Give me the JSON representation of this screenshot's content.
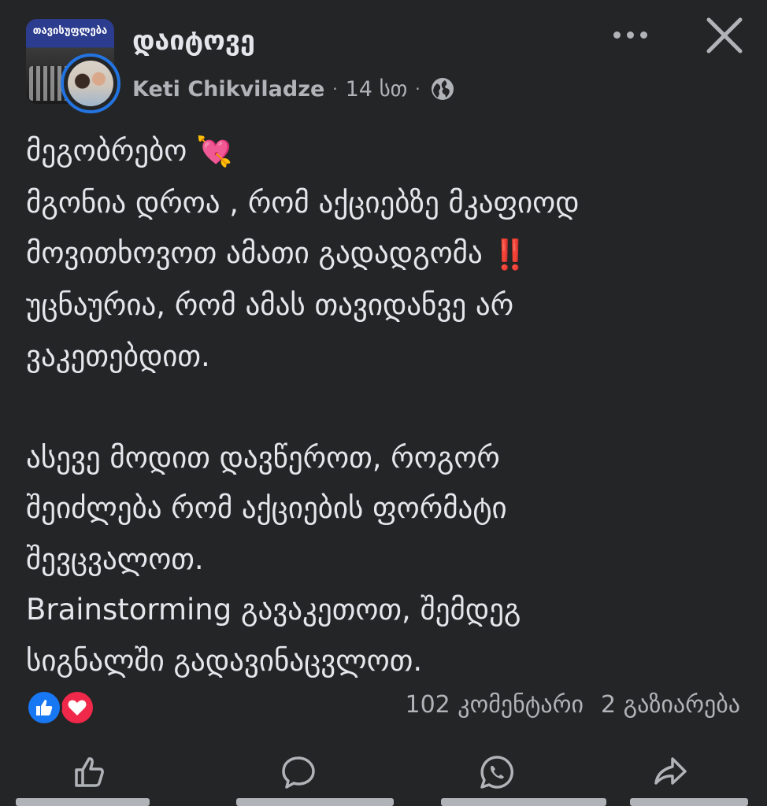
{
  "header": {
    "group_name": "დაიტოვე",
    "author": "Keti Chikviladze",
    "separator": "·",
    "time": "14 სთ",
    "group_avatar_text": "თავისუფლება",
    "more_icon": "more-horizontal-icon",
    "close_icon": "close-icon",
    "privacy_icon": "globe-icon"
  },
  "post": {
    "lines": [
      "მეგობრებო",
      "მგონია დროა , რომ აქციებზე მკაფიოდ",
      "მოვითხოვოთ ამათი გადადგომა",
      "უცნაურია, რომ ამას თავიდანვე არ",
      "ვაკეთებდით.",
      "",
      "ასევე მოდით დავწეროთ, როგორ",
      "შეიძლება რომ აქციების ფორმატი",
      "შევცვალოთ.",
      "Brainstorming გავაკეთოთ, შემდეგ",
      "სიგნალში გადავინაცვლოთ."
    ],
    "emoji_heart_arrow": "💘",
    "emoji_double_exclamation": "‼️"
  },
  "stats": {
    "reaction_icons": [
      "like-icon",
      "love-icon"
    ],
    "comments": "102 კომენტარი",
    "shares": "2 გაზიარება"
  },
  "actions": [
    {
      "name": "like-button",
      "icon": "thumbs-up-icon"
    },
    {
      "name": "comment-button",
      "icon": "comment-icon"
    },
    {
      "name": "whatsapp-button",
      "icon": "whatsapp-icon"
    },
    {
      "name": "share-button",
      "icon": "share-icon"
    }
  ],
  "colors": {
    "background": "#242526",
    "text": "#e4e6eb",
    "secondary": "#b0b3b8",
    "accent": "#2374e1",
    "like": "#1877f2",
    "love": "#f02849"
  }
}
